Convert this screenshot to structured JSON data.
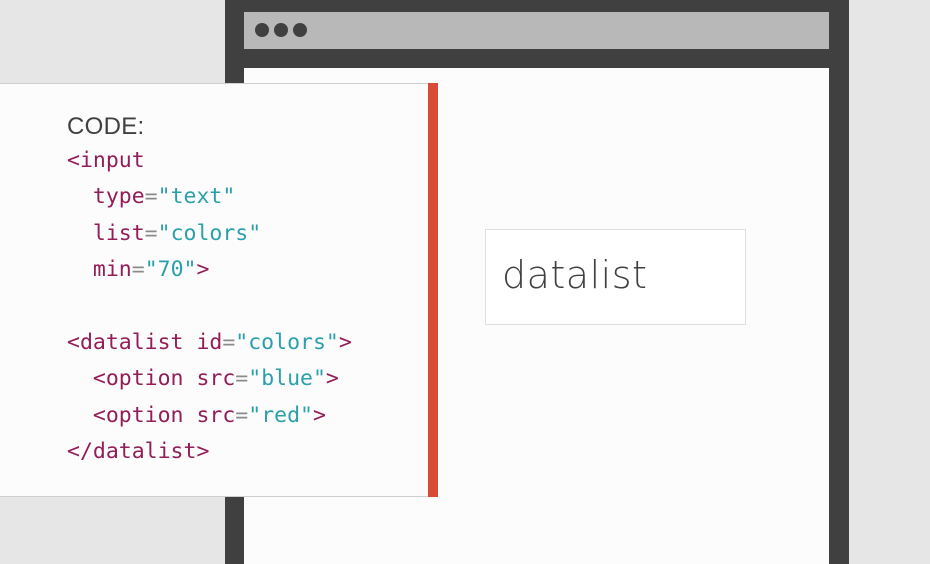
{
  "browser": {
    "field_text": "datalist"
  },
  "code_card": {
    "title": "CODE:",
    "accent_color": "#d94b36",
    "lines": [
      {
        "indent": "",
        "parts": [
          {
            "t": "tag",
            "s": "<input"
          }
        ]
      },
      {
        "indent": "  ",
        "parts": [
          {
            "t": "attr",
            "s": "type"
          },
          {
            "t": "eq",
            "s": "="
          },
          {
            "t": "val",
            "s": "\"text\""
          }
        ]
      },
      {
        "indent": "  ",
        "parts": [
          {
            "t": "attr",
            "s": "list"
          },
          {
            "t": "eq",
            "s": "="
          },
          {
            "t": "val",
            "s": "\"colors\""
          }
        ]
      },
      {
        "indent": "  ",
        "parts": [
          {
            "t": "attr",
            "s": "min"
          },
          {
            "t": "eq",
            "s": "="
          },
          {
            "t": "val",
            "s": "\"70\""
          },
          {
            "t": "tag",
            "s": ">"
          }
        ]
      },
      {
        "indent": "",
        "parts": []
      },
      {
        "indent": "",
        "parts": [
          {
            "t": "tag",
            "s": "<datalist "
          },
          {
            "t": "attr",
            "s": "id"
          },
          {
            "t": "eq",
            "s": "="
          },
          {
            "t": "val",
            "s": "\"colors\""
          },
          {
            "t": "tag",
            "s": ">"
          }
        ]
      },
      {
        "indent": "  ",
        "parts": [
          {
            "t": "tag",
            "s": "<option "
          },
          {
            "t": "attr",
            "s": "src"
          },
          {
            "t": "eq",
            "s": "="
          },
          {
            "t": "val",
            "s": "\"blue\""
          },
          {
            "t": "tag",
            "s": ">"
          }
        ]
      },
      {
        "indent": "  ",
        "parts": [
          {
            "t": "tag",
            "s": "<option "
          },
          {
            "t": "attr",
            "s": "src"
          },
          {
            "t": "eq",
            "s": "="
          },
          {
            "t": "val",
            "s": "\"red\""
          },
          {
            "t": "tag",
            "s": ">"
          }
        ]
      },
      {
        "indent": "",
        "parts": [
          {
            "t": "tag",
            "s": "</datalist>"
          }
        ]
      }
    ]
  },
  "colors": {
    "tag": "#931d57",
    "value": "#2aa0ac",
    "equals": "#8a8a8a"
  }
}
